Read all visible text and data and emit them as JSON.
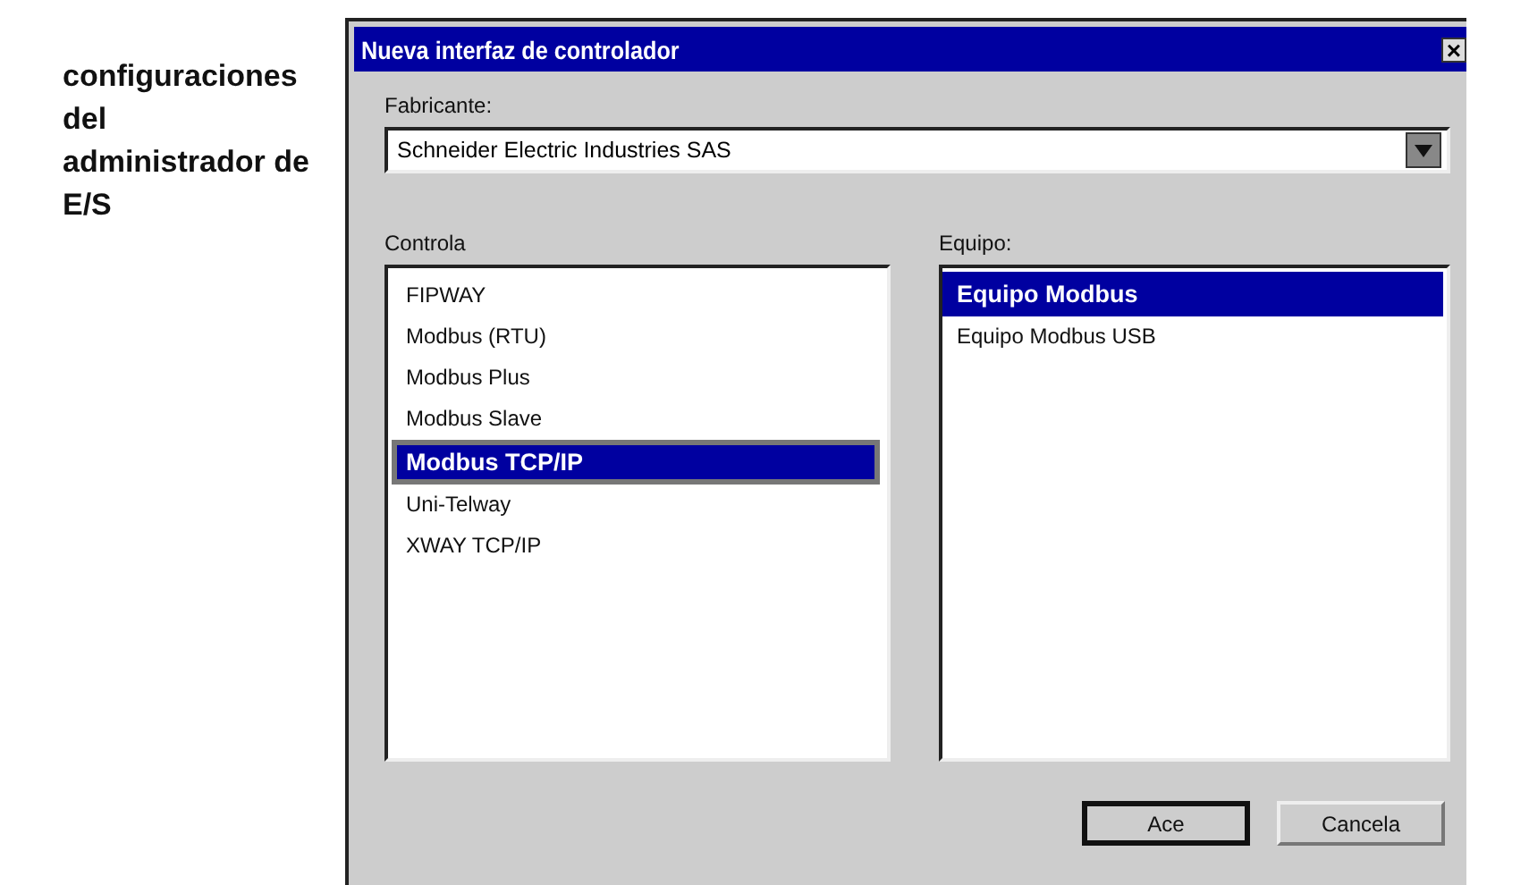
{
  "caption": [
    "configuraciones",
    "del",
    "administrador de",
    "E/S"
  ],
  "window": {
    "title": "Nueva interfaz de controlador",
    "close": "×"
  },
  "manufacturer": {
    "label": "Fabricante:",
    "value": "Schneider Electric Industries SAS"
  },
  "controllers": {
    "label": "Controla",
    "items": [
      {
        "label": "FIPWAY",
        "selected": false
      },
      {
        "label": "Modbus (RTU)",
        "selected": false
      },
      {
        "label": "Modbus Plus",
        "selected": false
      },
      {
        "label": "Modbus Slave",
        "selected": false
      },
      {
        "label": "Modbus TCP/IP",
        "selected": true
      },
      {
        "label": "Uni-Telway",
        "selected": false
      },
      {
        "label": "XWAY TCP/IP",
        "selected": false
      }
    ]
  },
  "equipment": {
    "label": "Equipo:",
    "items": [
      {
        "label": "Equipo Modbus",
        "selected": true
      },
      {
        "label": "Equipo Modbus USB",
        "selected": false
      }
    ]
  },
  "buttons": [
    {
      "label": "Ace",
      "kind": "default"
    },
    {
      "label": "Cancela",
      "kind": "normal"
    }
  ]
}
